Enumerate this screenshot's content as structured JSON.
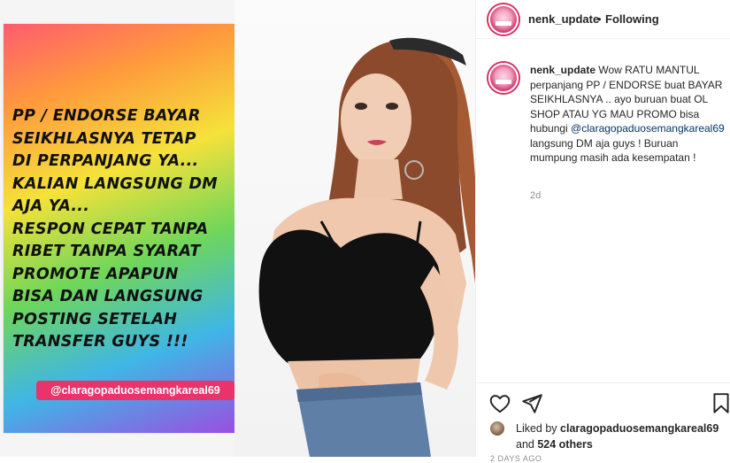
{
  "post": {
    "promo_lines": [
      "PP / ENDORSE BAYAR",
      "SEIKHLASNYA TETAP",
      "DI PERPANJANG YA...",
      "KALIAN LANGSUNG DM",
      "AJA YA...",
      "RESPON CEPAT TANPA",
      "RIBET TANPA SYARAT",
      "PROMOTE APAPUN",
      "BISA DAN LANGSUNG",
      "POSTING SETELAH",
      "TRANSFER GUYS !!!"
    ],
    "promo_tag": "@claragopaduosemangkareal69"
  },
  "header": {
    "username": "nenk_update",
    "separator": "•",
    "follow_status": "Following"
  },
  "caption": {
    "username": "nenk_update",
    "text_before_mention": " Wow RATU MANTUL perpanjang PP / ENDORSE buat BAYAR SEIKHLASNYA .. ayo buruan buat OL SHOP ATAU YG MAU PROMO bisa hubungi ",
    "mention": "@claragopaduosemangkareal69",
    "text_after_mention": " langsung DM aja guys ! Buruan mumpung masih ada kesempatan !",
    "time": "2d"
  },
  "likes": {
    "prefix": "Liked by ",
    "user": "claragopaduosemangkareal69",
    "middle": " and ",
    "others": "524 others"
  },
  "timestamp_partial": "2 DAYS AGO",
  "icons": {
    "like": "heart-icon",
    "share": "paper-plane-icon",
    "save": "bookmark-icon"
  },
  "colors": {
    "mention": "#00376b",
    "tag_background": "#e8336b",
    "avatar_ring": "#d72d5e",
    "muted": "#8e8e8e"
  }
}
